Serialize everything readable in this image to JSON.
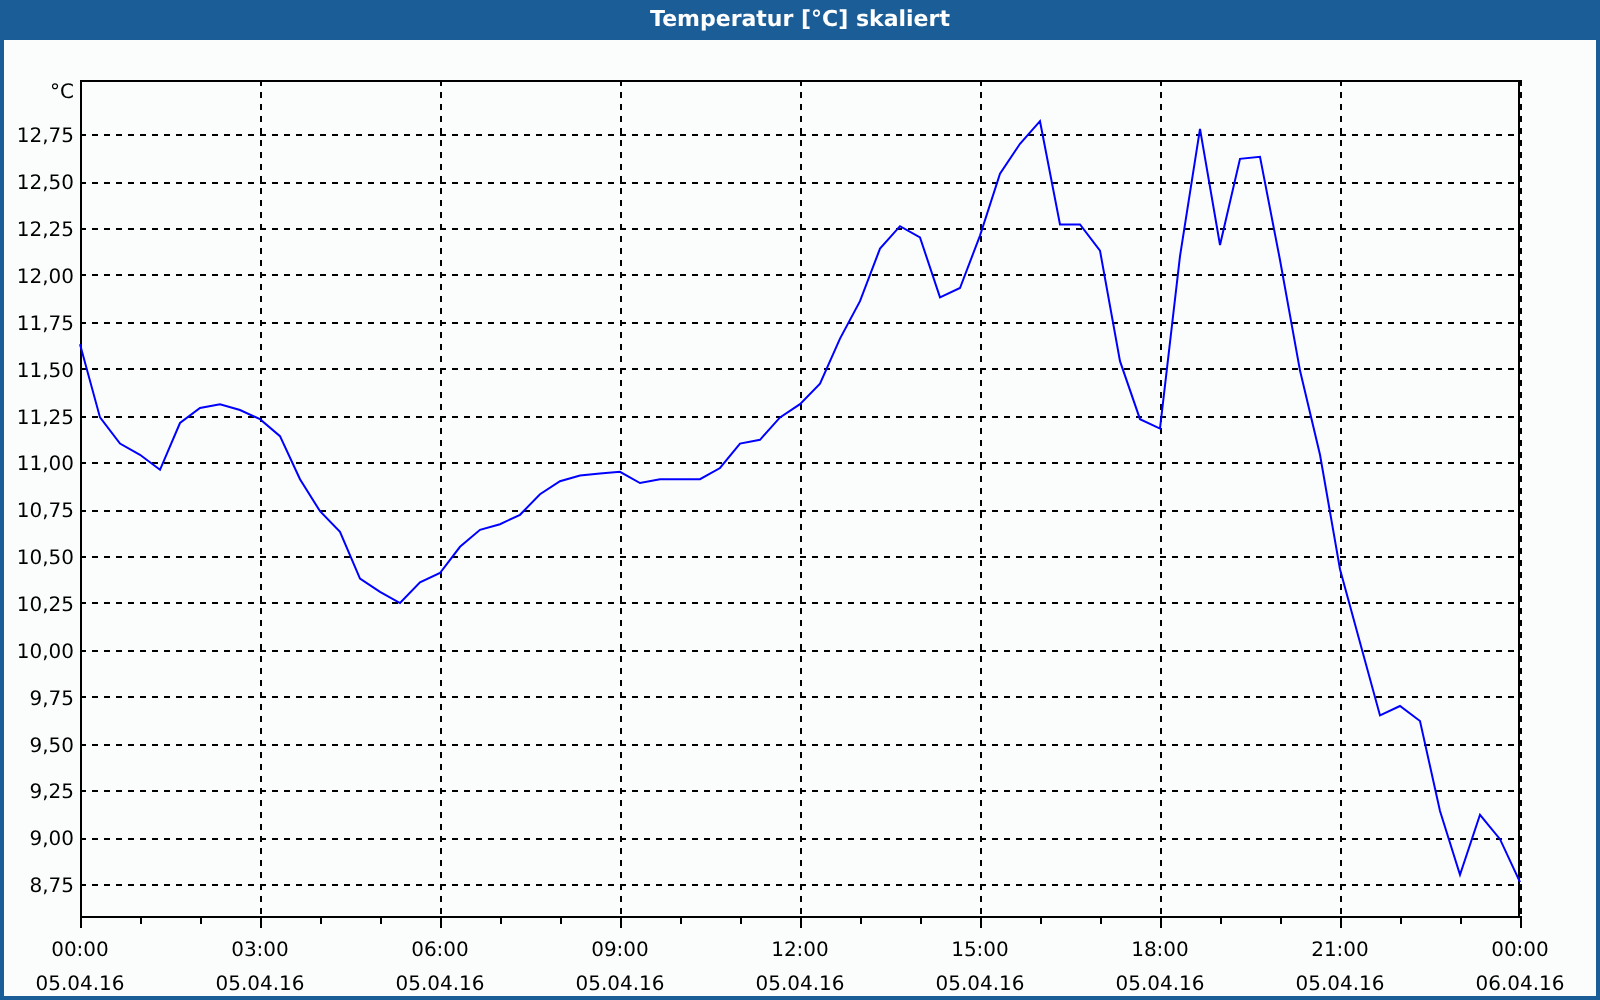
{
  "window": {
    "title": "Temperatur [°C] skaliert"
  },
  "chart": {
    "chart_data": {
      "type": "line",
      "grid": true,
      "ylabel": "°C",
      "ylim": [
        8.58,
        13.04
      ],
      "categories": [
        "00:00 05.04.16",
        null,
        null,
        null,
        null,
        null,
        null,
        null,
        null,
        "03:00 05.04.16",
        null,
        null,
        null,
        null,
        null,
        null,
        null,
        null,
        "06:00 05.04.16",
        null,
        null,
        null,
        null,
        null,
        null,
        null,
        null,
        "09:00 05.04.16",
        null,
        null,
        null,
        null,
        null,
        null,
        null,
        null,
        "12:00 05.04.16",
        null,
        null,
        null,
        null,
        null,
        null,
        null,
        null,
        "15:00 05.04.16",
        null,
        null,
        null,
        null,
        null,
        null,
        null,
        null,
        "18:00 05.04.16",
        null,
        null,
        null,
        null,
        null,
        null,
        null,
        null,
        "21:00 05.04.16",
        null,
        null,
        null,
        null,
        null,
        null,
        null,
        null,
        "00:00 06.04.16"
      ],
      "yticks": [
        {
          "value": 8.75,
          "label": "8,75"
        },
        {
          "value": 9,
          "label": "9,00"
        },
        {
          "value": 9.25,
          "label": "9,25"
        },
        {
          "value": 9.5,
          "label": "9,50"
        },
        {
          "value": 9.75,
          "label": "9,75"
        },
        {
          "value": 10,
          "label": "10,00"
        },
        {
          "value": 10.25,
          "label": "10,25"
        },
        {
          "value": 10.5,
          "label": "10,50"
        },
        {
          "value": 10.75,
          "label": "10,75"
        },
        {
          "value": 11,
          "label": "11,00"
        },
        {
          "value": 11.25,
          "label": "11,25"
        },
        {
          "value": 11.5,
          "label": "11,50"
        },
        {
          "value": 11.75,
          "label": "11,75"
        },
        {
          "value": 12,
          "label": "12,00"
        },
        {
          "value": 12.25,
          "label": "12,25"
        },
        {
          "value": 12.5,
          "label": "12,50"
        },
        {
          "value": 12.75,
          "label": "12,75"
        }
      ],
      "series": [
        {
          "color": "#0000ff",
          "values": [
            11.63,
            11.24,
            11.1,
            11.04,
            10.96,
            11.21,
            11.29,
            11.31,
            11.28,
            11.23,
            11.14,
            10.91,
            10.74,
            10.63,
            10.38,
            10.31,
            10.25,
            10.36,
            10.41,
            10.55,
            10.64,
            10.67,
            10.72,
            10.83,
            10.9,
            10.93,
            10.94,
            10.95,
            10.89,
            10.91,
            10.91,
            10.91,
            10.97,
            11.1,
            11.12,
            11.24,
            11.31,
            11.42,
            11.66,
            11.86,
            12.14,
            12.26,
            12.2,
            11.88,
            11.93,
            12.21,
            12.54,
            12.7,
            12.82,
            12.27,
            12.27,
            12.13,
            11.54,
            11.23,
            11.18,
            12.1,
            12.78,
            12.16,
            12.62,
            12.63,
            12.08,
            11.49,
            11.04,
            10.43,
            10.04,
            9.65,
            9.7,
            9.62,
            9.14,
            8.8,
            9.12,
            8.99,
            8.76
          ]
        }
      ]
    }
  }
}
